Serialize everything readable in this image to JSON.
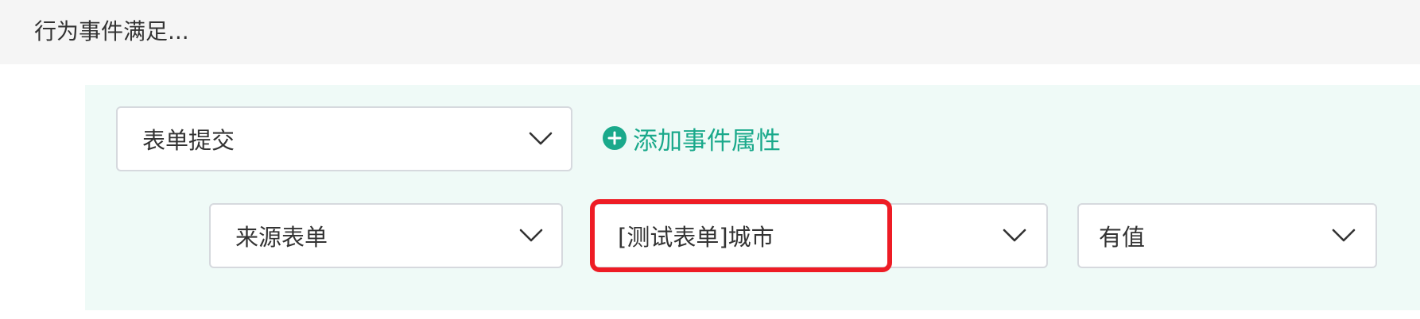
{
  "header": {
    "title": "行为事件满足..."
  },
  "event_row": {
    "event_select": {
      "value": "表单提交",
      "icon": "chevron-down-icon"
    },
    "add_property": {
      "icon": "plus-circle-icon",
      "label": "添加事件属性"
    }
  },
  "condition_row": {
    "source_select": {
      "value": "来源表单",
      "icon": "chevron-down-icon"
    },
    "field_select": {
      "value": "[测试表单]城市",
      "icon": "chevron-down-icon",
      "highlighted": true
    },
    "operator_select": {
      "value": "有值",
      "icon": "chevron-down-icon"
    }
  },
  "colors": {
    "accent": "#1aa98b",
    "panel_bg": "#effaf7",
    "header_bg": "#f5f5f5",
    "highlight_border": "#ee1c25"
  }
}
